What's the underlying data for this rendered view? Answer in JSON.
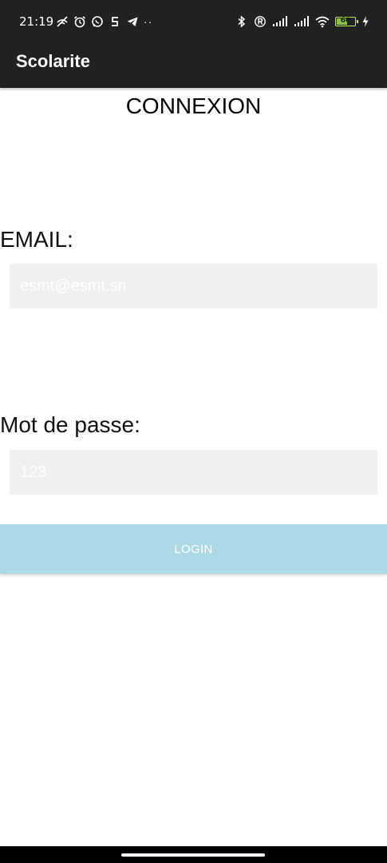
{
  "status_bar": {
    "time": "21:19",
    "icons_left": [
      "wifi-call-off-icon",
      "alarm-icon",
      "whatsapp-icon",
      "s-app-icon",
      "telegram-icon",
      "more-dots-icon"
    ],
    "dots": "··",
    "icons_right": [
      "bluetooth-icon",
      "registered-icon",
      "signal-icon",
      "signal-icon",
      "wifi-icon",
      "battery-icon"
    ],
    "battery_level": "60",
    "battery_fraction": 0.6,
    "battery_color": "#8bc34a"
  },
  "app_bar": {
    "title": "Scolarite",
    "background": "#212121"
  },
  "login": {
    "title": "CONNEXION",
    "email_label": "EMAIL:",
    "email_placeholder": "esmt@esmt.sn",
    "password_label": "Mot de passe:",
    "password_placeholder": "123",
    "button_label": "LOGIN",
    "button_color": "#add8e6"
  }
}
